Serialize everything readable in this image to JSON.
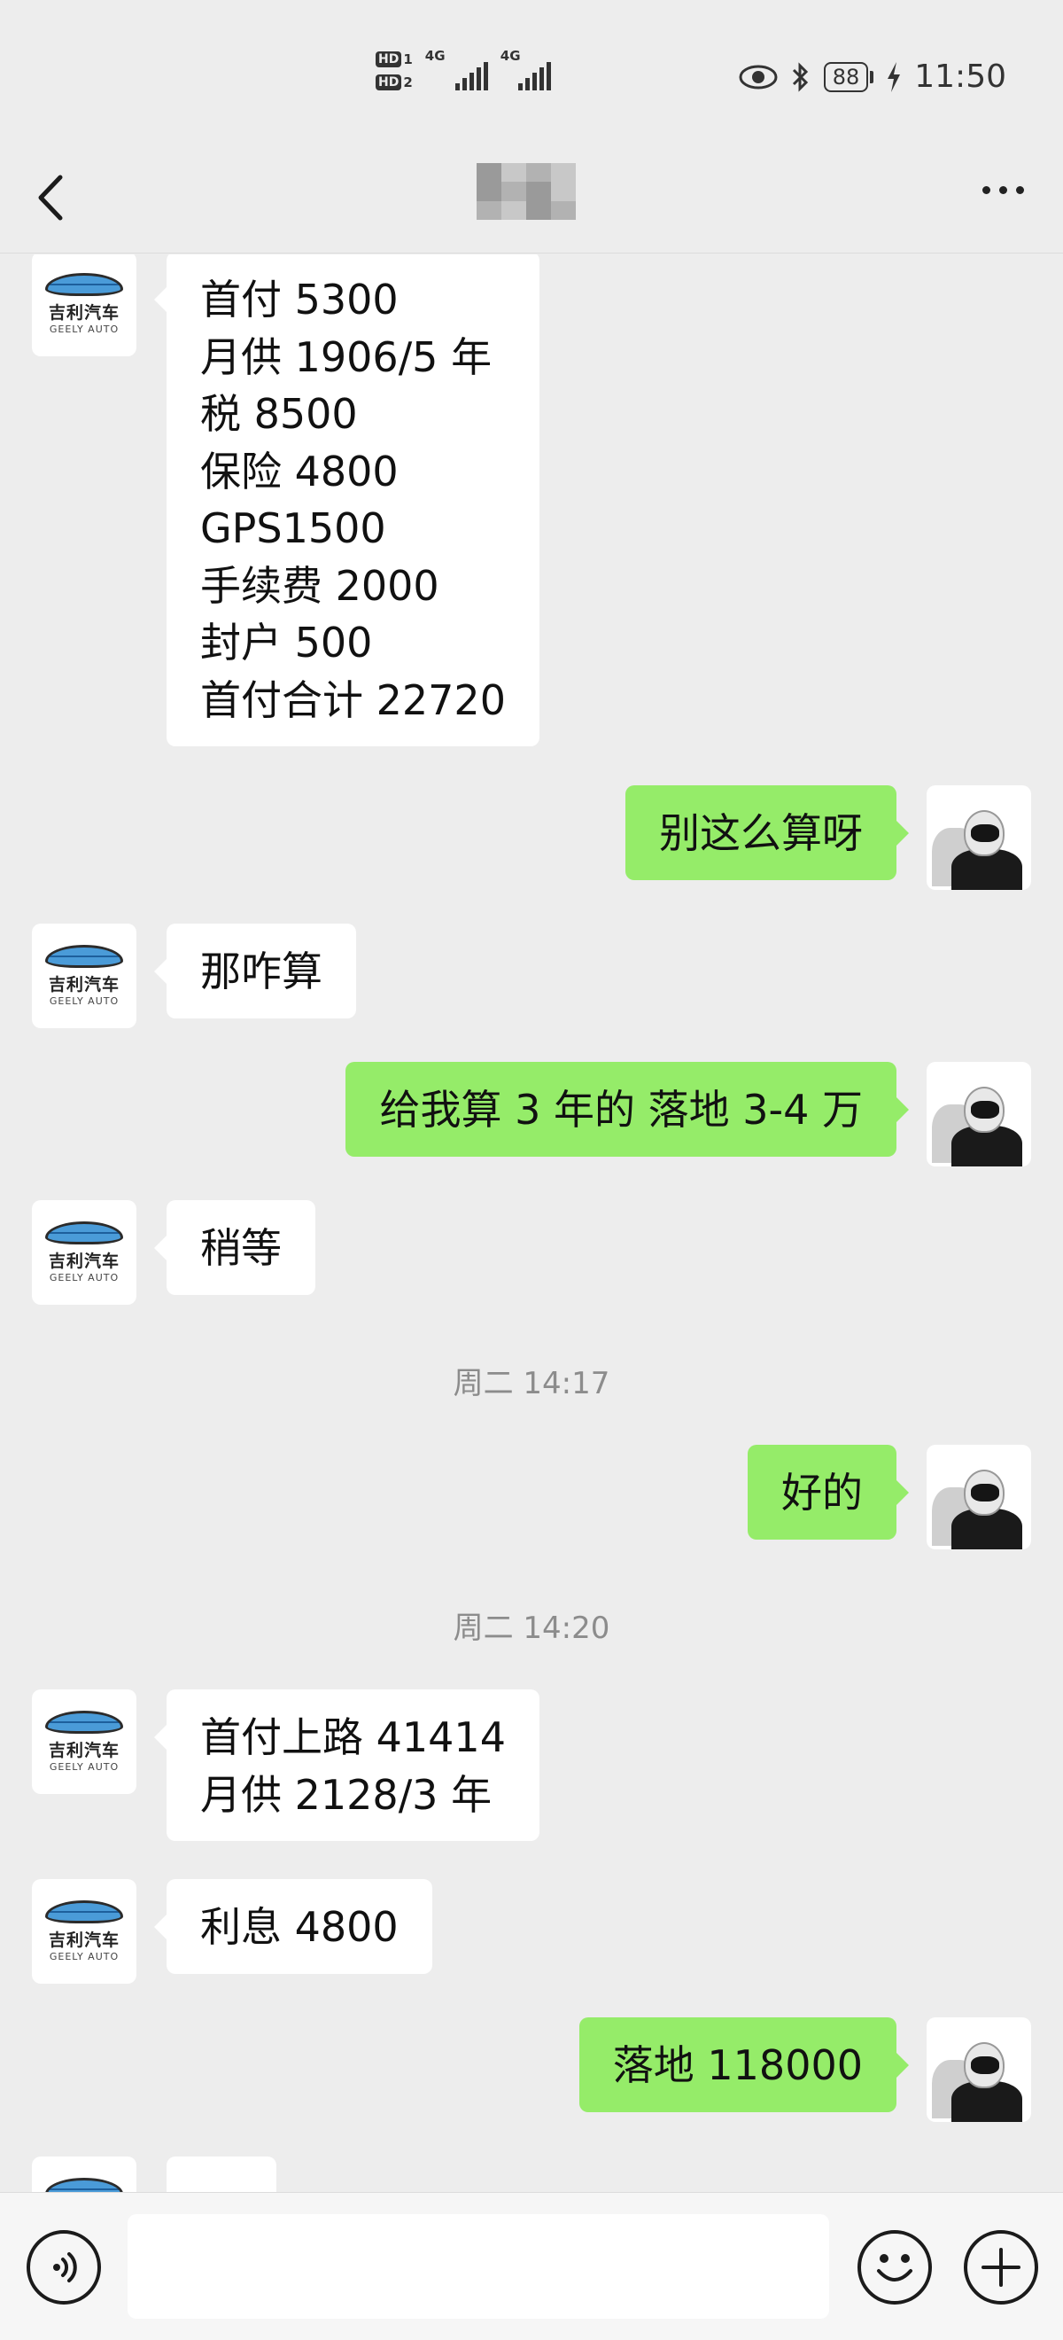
{
  "status_bar": {
    "hd1": "HD",
    "hd1_num": "1",
    "hd2": "HD",
    "hd2_num": "2",
    "net1": "4G",
    "net2": "4G",
    "battery": "88",
    "time": "11:50"
  },
  "nav": {
    "back_icon": "chevron-left-icon",
    "title_obscured": true,
    "more_icon": "more-dots-icon"
  },
  "contact_avatar": {
    "brand_cn": "吉利汽车",
    "brand_en": "GEELY AUTO"
  },
  "messages": [
    {
      "side": "in",
      "text": "首付 5300\n月供 1906/5 年\n税 8500\n保险 4800\nGPS1500\n手续费 2000\n封户 500\n首付合计 22720"
    },
    {
      "side": "out",
      "text": "别这么算呀"
    },
    {
      "side": "in",
      "text": "那咋算"
    },
    {
      "side": "out",
      "text": "给我算 3 年的  落地 3-4 万"
    },
    {
      "side": "in",
      "text": "稍等"
    },
    {
      "side": "out",
      "text": "好的"
    },
    {
      "side": "in",
      "text": "首付上路 41414\n月供 2128/3 年"
    },
    {
      "side": "in",
      "text": "利息 4800"
    },
    {
      "side": "out",
      "text": "落地 118000"
    },
    {
      "side": "in",
      "text": ""
    }
  ],
  "timestamps": [
    "周二 14:17",
    "周二 14:20"
  ],
  "input_bar": {
    "voice_icon": "voice-icon",
    "input_value": "",
    "emoji_icon": "emoji-icon",
    "plus_icon": "plus-icon"
  },
  "colors": {
    "background": "#ededed",
    "outgoing_bubble": "#95ec69",
    "incoming_bubble": "#ffffff",
    "timestamp": "#8c8c8c"
  }
}
